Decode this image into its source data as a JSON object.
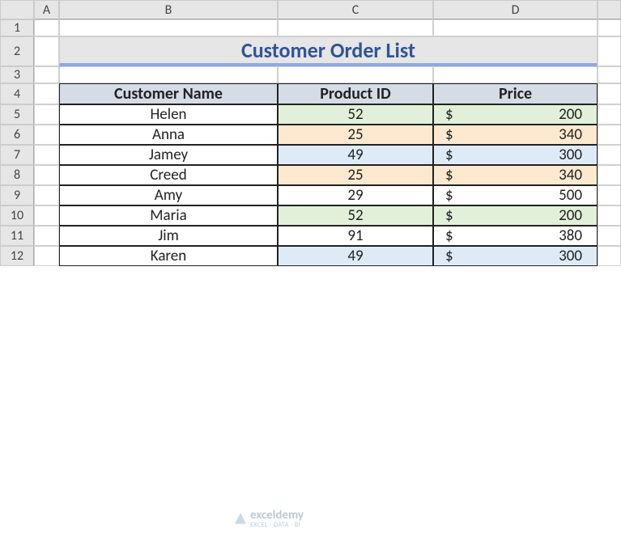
{
  "columns": [
    "",
    "A",
    "B",
    "C",
    "D",
    ""
  ],
  "rows": [
    "1",
    "2",
    "3",
    "4",
    "5",
    "6",
    "7",
    "8",
    "9",
    "10",
    "11",
    "12"
  ],
  "title": "Customer Order List",
  "headers": {
    "name": "Customer Name",
    "pid": "Product ID",
    "price": "Price"
  },
  "currency": "$",
  "data": [
    {
      "name": "Helen",
      "pid": "52",
      "price": "200",
      "fill": "green"
    },
    {
      "name": "Anna",
      "pid": "25",
      "price": "340",
      "fill": "orange"
    },
    {
      "name": "Jamey",
      "pid": "49",
      "price": "300",
      "fill": "blue"
    },
    {
      "name": "Creed",
      "pid": "25",
      "price": "340",
      "fill": "orange"
    },
    {
      "name": "Amy",
      "pid": "29",
      "price": "500",
      "fill": ""
    },
    {
      "name": "Maria",
      "pid": "52",
      "price": "200",
      "fill": "green"
    },
    {
      "name": "Jim",
      "pid": "91",
      "price": "380",
      "fill": ""
    },
    {
      "name": "Karen",
      "pid": "49",
      "price": "300",
      "fill": "blue"
    }
  ],
  "watermark": {
    "brand": "exceldemy",
    "tagline": "EXCEL · DATA · BI"
  }
}
